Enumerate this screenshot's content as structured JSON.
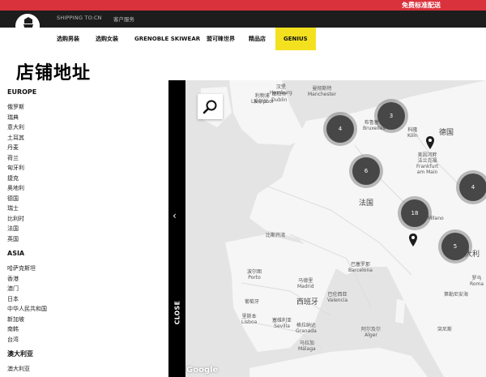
{
  "promo": {
    "text": "免费标准配送"
  },
  "topbar": {
    "shipping_label": "SHIPPING TO:",
    "country": "CN",
    "customer_service": "客户服务"
  },
  "nav": {
    "items": [
      {
        "label": "选购男装"
      },
      {
        "label": "选购女装"
      },
      {
        "label": "GRENOBLE SKIWEAR"
      },
      {
        "label": "盟可睐世界"
      },
      {
        "label": "精品店"
      },
      {
        "label": "GENIUS"
      }
    ]
  },
  "page_title": "店铺地址",
  "store_list": {
    "regions": [
      {
        "name": "EUROPE",
        "countries": [
          "俄罗斯",
          "瑞典",
          "意大利",
          "土耳其",
          "丹麦",
          "荷兰",
          "匈牙利",
          "捷克",
          "奥地利",
          "德国",
          "瑞士",
          "比利时",
          "法国",
          "英国"
        ]
      },
      {
        "name": "ASIA",
        "countries": [
          "哈萨克斯坦",
          "香港",
          "澳门",
          "日本",
          "中华人民共和国",
          "新加坡",
          "南韩",
          "台湾"
        ]
      },
      {
        "name": "澳大利亚",
        "countries": [
          "澳大利亚"
        ]
      }
    ]
  },
  "map": {
    "close_label": "CLOSE",
    "chevron": "‹",
    "clusters": [
      "4",
      "3",
      "6",
      "18",
      "4",
      "5"
    ],
    "labels": {
      "ireland": "爱尔兰",
      "dublin": "都柏林\nDublin",
      "manchester": "曼彻斯特\nManchester",
      "liverpool": "利物浦\nLiverpool",
      "hamburg": "汉堡\nHamburg",
      "germany": "德国",
      "brussels": "布鲁塞尔\nBruxelles",
      "cologne": "科隆\nKöln",
      "frankfurt": "美因河畔\n法兰克福\nFrankfurt\nam Main",
      "france": "法国",
      "milano": "Milano",
      "italy": "意大利",
      "rome": "罗马\nRoma",
      "barcelona": "巴塞罗那\nBarcelona",
      "porto": "波尔图\nPorto",
      "madrid": "马德里\nMadrid",
      "portugal": "葡萄牙",
      "spain": "西班牙",
      "valencia": "巴伦西亚\nValencia",
      "lisbon": "里斯本\nLisboa",
      "seville": "塞维利亚\nSevilla",
      "granada": "格拉纳达\nGranada",
      "malaga": "马拉加\nMálaga",
      "algiers": "阿尔及尔\nAlger",
      "tunis": "突尼斯",
      "bay_biscay": "比斯开湾",
      "tyrrhenian": "第勒尼安海",
      "google": "Google"
    }
  },
  "colors": {
    "promo": "#d9323c",
    "header": "#1d1d1d",
    "highlight": "#f3e11f",
    "cluster": "#474747"
  }
}
